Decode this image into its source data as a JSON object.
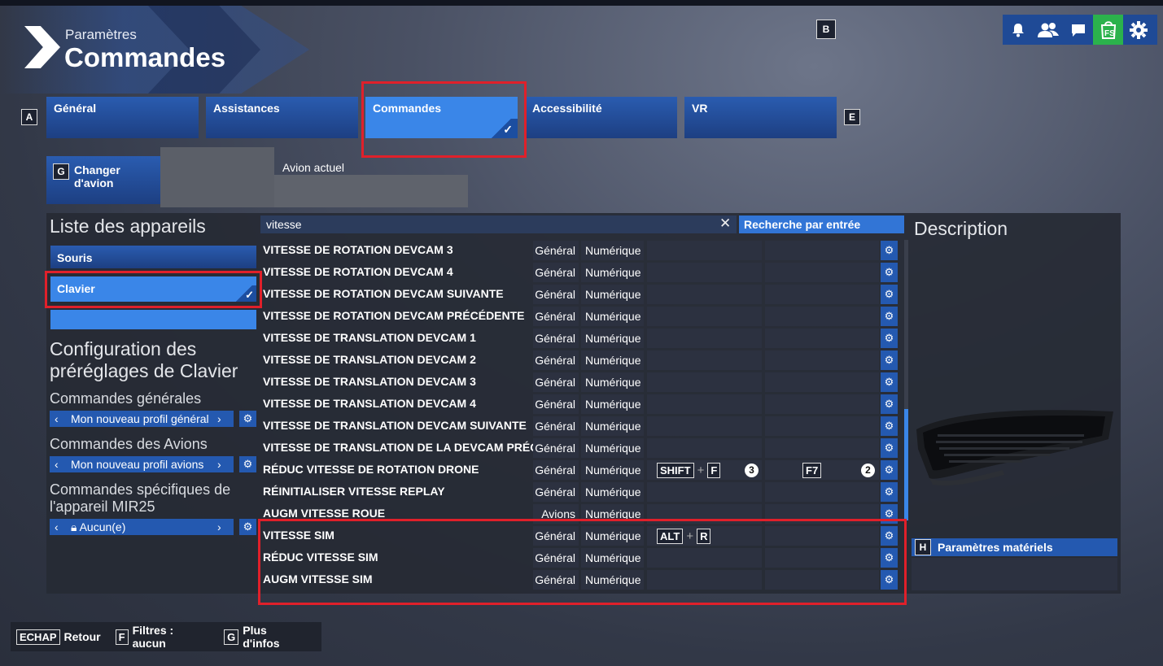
{
  "header": {
    "subtitle": "Paramètres",
    "title": "Commandes",
    "key_b": "B",
    "icons": [
      "bell-icon",
      "friends-icon",
      "chat-icon",
      "marketplace-icon",
      "gear-icon"
    ],
    "colors": {
      "accent": "#3a86e8",
      "brand": "#1f4a96",
      "marketplace": "#2bb24c",
      "highlight": "#e0202a"
    }
  },
  "tabs": {
    "key_left": "A",
    "key_right": "E",
    "items": [
      {
        "label": "Général"
      },
      {
        "label": "Assistances"
      },
      {
        "label": "Commandes"
      },
      {
        "label": "Accessibilité"
      },
      {
        "label": "VR"
      }
    ]
  },
  "plane": {
    "key": "G",
    "change_label": "Changer d'avion",
    "current_label": "Avion actuel"
  },
  "devices": {
    "title": "Liste des appareils",
    "items": [
      {
        "label": "Souris"
      },
      {
        "label": "Clavier"
      }
    ]
  },
  "presets": {
    "title": "Configuration des préréglages de Clavier",
    "general_label": "Commandes générales",
    "general_value": "Mon nouveau profil général",
    "planes_label": "Commandes des Avions",
    "planes_value": "Mon nouveau profil avions",
    "device_label": "Commandes spécifiques de l'appareil MIR25",
    "device_value": "Aucun(e)"
  },
  "search": {
    "value": "vitesse",
    "clear": "✕",
    "button_label": "Recherche par entrée"
  },
  "bindings": [
    {
      "name": "VITESSE DE ROTATION DEVCAM 3",
      "cat": "Général",
      "type": "Numérique"
    },
    {
      "name": "VITESSE DE ROTATION DEVCAM 4",
      "cat": "Général",
      "type": "Numérique"
    },
    {
      "name": "VITESSE DE ROTATION DEVCAM SUIVANTE",
      "cat": "Général",
      "type": "Numérique"
    },
    {
      "name": "VITESSE DE ROTATION DEVCAM PRÉCÉDENTE",
      "cat": "Général",
      "type": "Numérique"
    },
    {
      "name": "VITESSE DE TRANSLATION DEVCAM 1",
      "cat": "Général",
      "type": "Numérique"
    },
    {
      "name": "VITESSE DE TRANSLATION DEVCAM 2",
      "cat": "Général",
      "type": "Numérique"
    },
    {
      "name": "VITESSE DE TRANSLATION DEVCAM 3",
      "cat": "Général",
      "type": "Numérique"
    },
    {
      "name": "VITESSE DE TRANSLATION DEVCAM 4",
      "cat": "Général",
      "type": "Numérique"
    },
    {
      "name": "VITESSE DE TRANSLATION DEVCAM SUIVANTE",
      "cat": "Général",
      "type": "Numérique"
    },
    {
      "name": "VITESSE DE TRANSLATION DE LA DEVCAM PRÉCÉDENTE",
      "cat": "Général",
      "type": "Numérique"
    },
    {
      "name": "RÉDUC VITESSE DE ROTATION DRONE",
      "cat": "Général",
      "type": "Numérique",
      "b1_k1": "SHIFT",
      "b1_plus": "+",
      "b1_k2": "F",
      "b1_num": "3",
      "b2_k1": "F7",
      "b2_num": "2"
    },
    {
      "name": "RÉINITIALISER VITESSE REPLAY",
      "cat": "Général",
      "type": "Numérique"
    },
    {
      "name": "AUGM VITESSE ROUE",
      "cat": "Avions",
      "type": "Numérique"
    },
    {
      "name": "VITESSE SIM",
      "cat": "Général",
      "type": "Numérique",
      "b1_k1": "ALT",
      "b1_plus": "+",
      "b1_k2": "R"
    },
    {
      "name": "RÉDUC VITESSE SIM",
      "cat": "Général",
      "type": "Numérique"
    },
    {
      "name": "AUGM VITESSE SIM",
      "cat": "Général",
      "type": "Numérique"
    }
  ],
  "description": {
    "title": "Description",
    "hw_key": "H",
    "hw_label": "Paramètres matériels"
  },
  "footer": {
    "back_key": "ECHAP",
    "back_label": "Retour",
    "filter_key": "F",
    "filter_label": "Filtres : aucun",
    "info_key": "G",
    "info_label": "Plus d'infos"
  }
}
